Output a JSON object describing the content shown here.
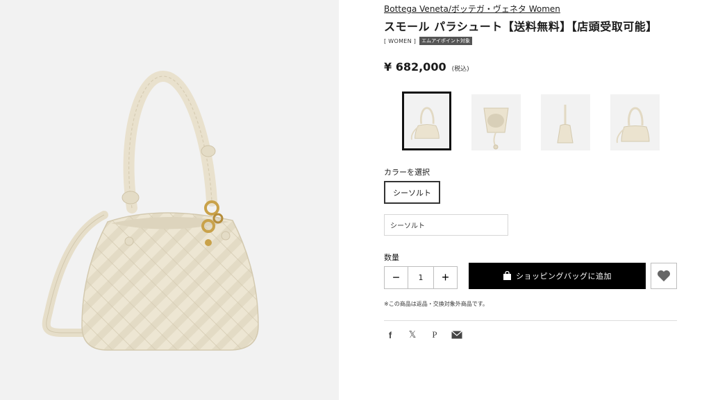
{
  "product": {
    "brand_link": "Bottega Veneta/ボッテガ・ヴェネタ  Women",
    "title": "スモール パラシュート【送料無料】【店頭受取可能】",
    "category_tag": "[ WOMEN ]",
    "points_tag": "エムアイポイント対象",
    "price": "¥ 682,000",
    "tax_note": "(税込)"
  },
  "gallery": {
    "main_image": "cream-woven-handbag",
    "thumbnails": [
      {
        "name": "front-view",
        "selected": true
      },
      {
        "name": "top-open-view",
        "selected": false
      },
      {
        "name": "side-view",
        "selected": false
      },
      {
        "name": "back-view",
        "selected": false
      }
    ]
  },
  "color": {
    "heading": "カラーを選択",
    "swatch_label": "シーソルト",
    "selected_value": "シーソルト"
  },
  "quantity": {
    "heading": "数量",
    "minus": "−",
    "value": "1",
    "plus": "+"
  },
  "actions": {
    "add_to_bag": "ショッピングバッグに追加",
    "bag_icon": "shopping-bag-icon",
    "wishlist_icon": "heart-icon"
  },
  "notice": "※この商品は返品・交換対象外商品です。",
  "share": {
    "facebook": "f",
    "x": "𝕏",
    "pinterest": "P"
  },
  "colors": {
    "bag": "#ede6d3",
    "bag_shadow": "#d8cfb8",
    "gold": "#c9a24a",
    "button": "#000000"
  }
}
